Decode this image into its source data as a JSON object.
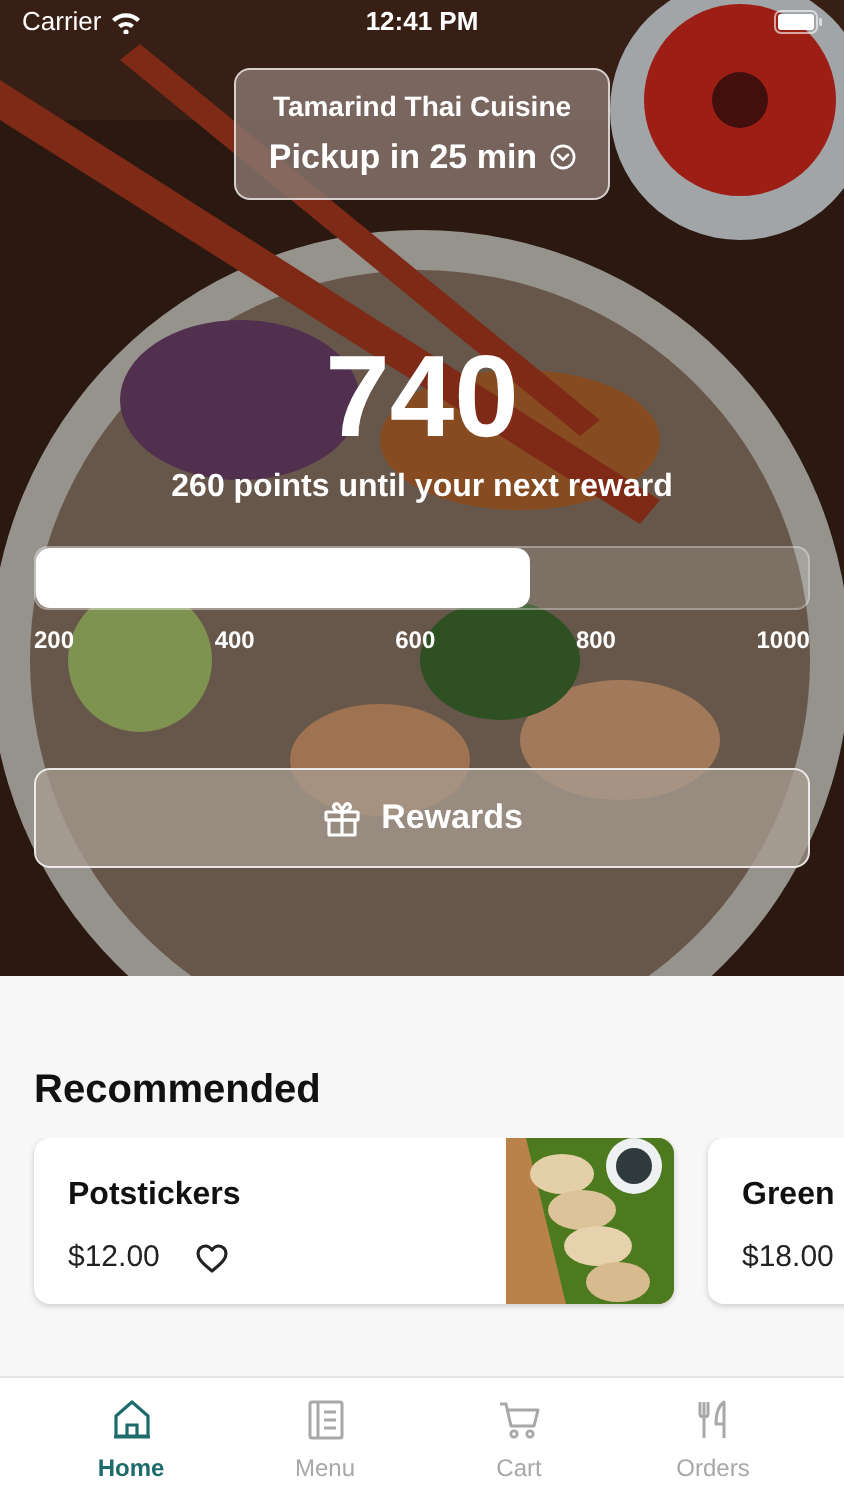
{
  "status_bar": {
    "carrier": "Carrier",
    "time": "12:41 PM"
  },
  "location": {
    "restaurant": "Tamarind Thai Cuisine",
    "pickup": "Pickup in 25 min"
  },
  "points": {
    "value": "740",
    "caption": "260 points until your next reward",
    "level": 0.64,
    "ticks": [
      "200",
      "400",
      "600",
      "800",
      "1000"
    ]
  },
  "rewards_button": {
    "label": "Rewards"
  },
  "recommended": {
    "title": "Recommended",
    "items": [
      {
        "name": "Potstickers",
        "price": "$12.00",
        "favorite": false,
        "kind": "picture"
      },
      {
        "name": "Green",
        "price": "$18.00"
      }
    ]
  },
  "tabs": [
    {
      "label": "Home",
      "kind": "home",
      "selected": true
    },
    {
      "label": "Menu",
      "kind": "menu",
      "selected": false
    },
    {
      "label": "Cart",
      "kind": "cart",
      "selected": false
    },
    {
      "label": "Orders",
      "kind": "orders",
      "selected": false
    }
  ]
}
